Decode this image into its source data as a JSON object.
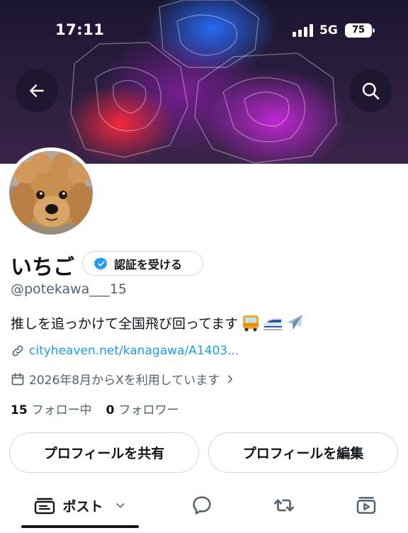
{
  "status_bar": {
    "time": "17:11",
    "network": "5G",
    "battery": "75"
  },
  "header": {
    "back_icon": "arrow-left-icon",
    "search_icon": "search-icon"
  },
  "profile": {
    "display_name": "いちご",
    "verify_button_label": "認証を受ける",
    "handle": "@potekawa___15",
    "bio": "推しを追っかけて全国飛び回ってます",
    "bio_emojis": [
      "bus",
      "bullet-train",
      "airplane"
    ],
    "link": "cityheaven.net/kanagawa/A1403...",
    "joined": "2026年8月からXを利用しています",
    "following_count": "15",
    "following_label": "フォロー中",
    "followers_count": "0",
    "followers_label": "フォロワー"
  },
  "actions": {
    "share_label": "プロフィールを共有",
    "edit_label": "プロフィールを編集"
  },
  "tabs": {
    "posts_label": "ポスト",
    "icons": [
      "replies-icon",
      "reposts-icon",
      "media-icon"
    ]
  },
  "colors": {
    "accent": "#1d9bf0",
    "text": "#0f1419",
    "muted": "#536471",
    "border": "#cfd9de",
    "verified": "#1d9bf0"
  }
}
